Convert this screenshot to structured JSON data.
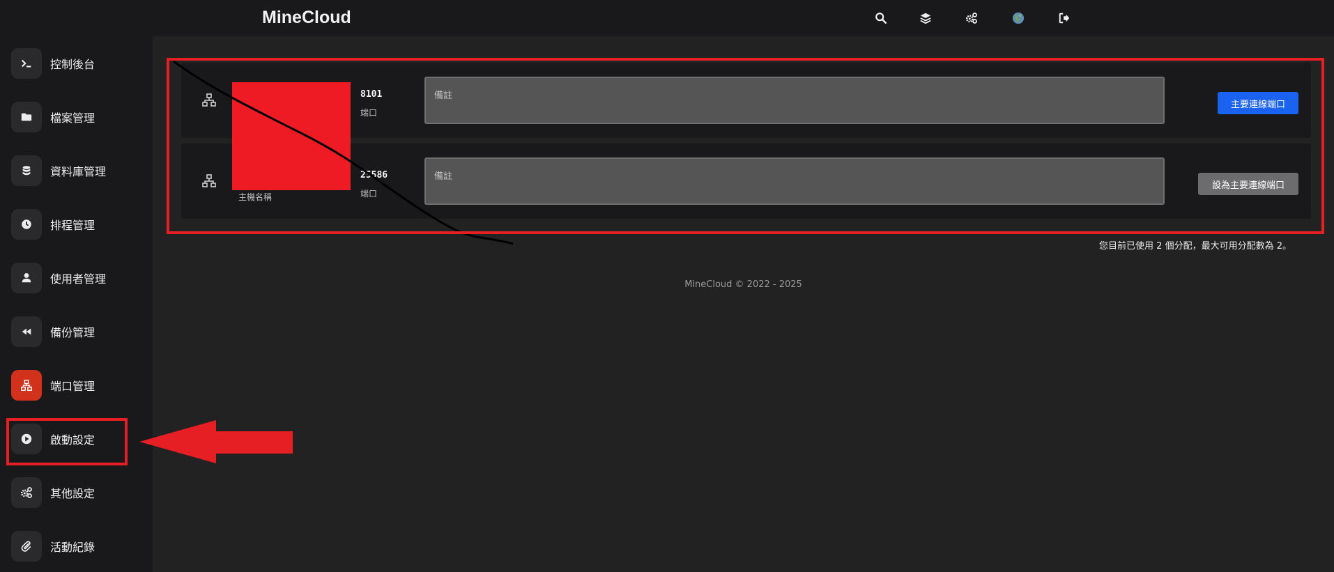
{
  "app": {
    "title": "MineCloud"
  },
  "topbar": {
    "icons": [
      "search-icon",
      "layers-icon",
      "cogs-icon",
      "globe-avatar-icon",
      "logout-icon"
    ]
  },
  "sidebar": {
    "items": [
      {
        "label": "控制後台",
        "icon": "terminal-icon",
        "active": false
      },
      {
        "label": "檔案管理",
        "icon": "folder-icon",
        "active": false
      },
      {
        "label": "資料庫管理",
        "icon": "database-icon",
        "active": false
      },
      {
        "label": "排程管理",
        "icon": "clock-icon",
        "active": false
      },
      {
        "label": "使用者管理",
        "icon": "user-icon",
        "active": false
      },
      {
        "label": "備份管理",
        "icon": "rewind-icon",
        "active": false
      },
      {
        "label": "端口管理",
        "icon": "network-icon",
        "active": true
      },
      {
        "label": "啟動設定",
        "icon": "play-icon",
        "active": false
      },
      {
        "label": "其他設定",
        "icon": "cogs-icon",
        "active": false
      },
      {
        "label": "活動紀錄",
        "icon": "paperclip-icon",
        "active": false
      }
    ]
  },
  "allocations": [
    {
      "port": "8101",
      "port_label": "端口",
      "note_placeholder": "備註",
      "button": "主要連線端口",
      "primary": true
    },
    {
      "port": "25586",
      "port_label": "端口",
      "host_label": "主機名稱",
      "note_placeholder": "備註",
      "button": "設為主要連線端口",
      "primary": false
    }
  ],
  "usage_text": "您目前已使用 2 個分配，最大可用分配數為 2。",
  "footer": "MineCloud © 2022 - 2025",
  "colors": {
    "background": "#222223",
    "panel": "#19191c",
    "active": "#d2311c",
    "primary_button": "#1a63f0",
    "annotation": "#e51f24"
  }
}
